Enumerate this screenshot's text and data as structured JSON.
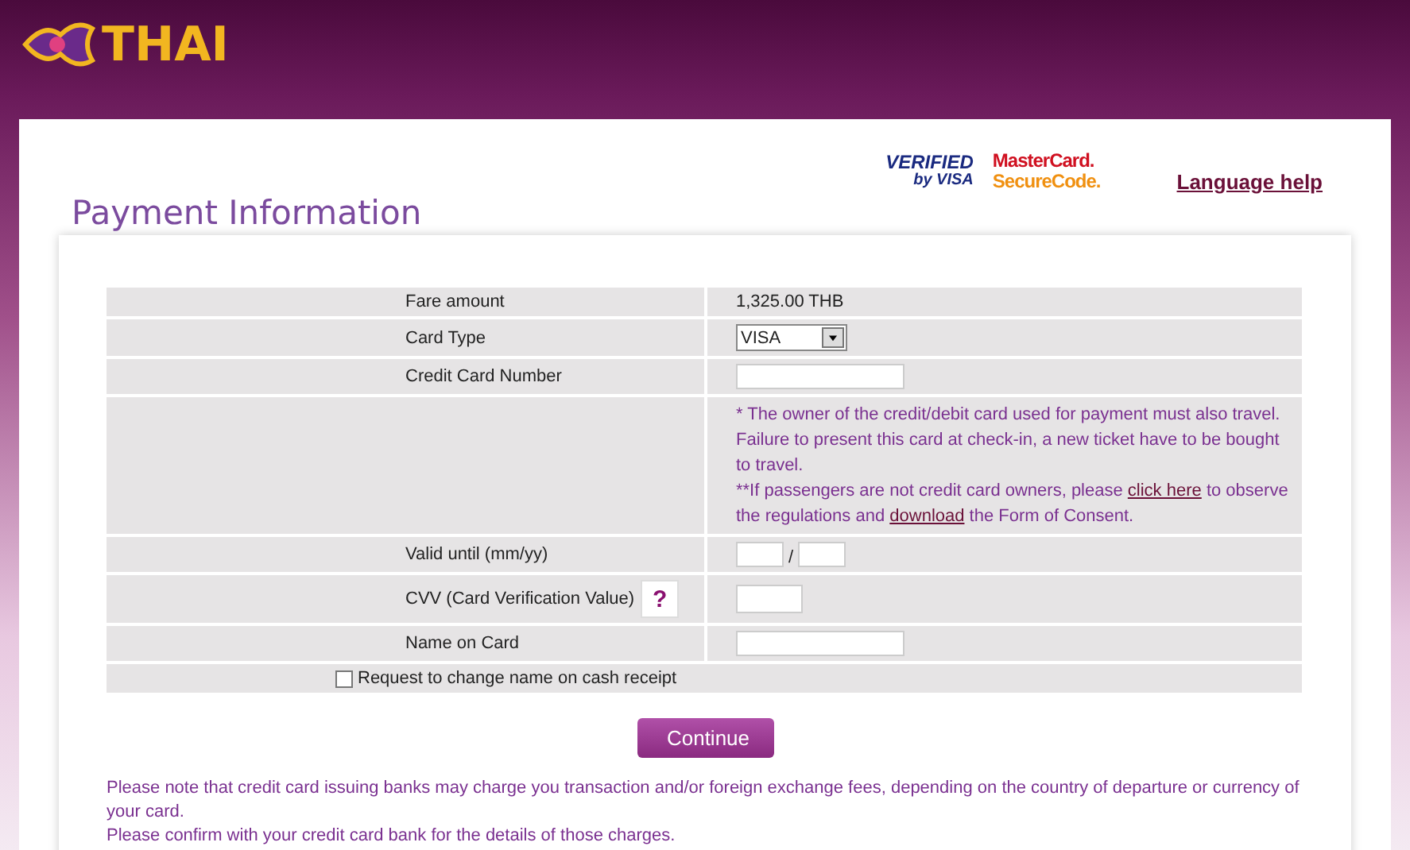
{
  "brand": {
    "name": "THAI"
  },
  "badges": {
    "visa": [
      "VERIFIED",
      "by VISA"
    ],
    "mastercard": [
      "MasterCard.",
      "SecureCode."
    ]
  },
  "language_link": "Language help",
  "title": "Payment Information",
  "rows": [
    {
      "kind": "text",
      "label": "Fare amount",
      "value": "1,325.00 THB"
    },
    {
      "kind": "select",
      "label": "Card Type",
      "value": "VISA"
    },
    {
      "kind": "long-input",
      "label": "Credit Card Number"
    },
    {
      "kind": "note",
      "lines": [
        "* The owner of the credit/debit card used for payment must also travel. Failure to present this card at check-in, a new ticket have to be bought to travel."
      ],
      "parts": [
        {
          "kind": "text",
          "text": "**If passengers are not credit card owners, please "
        },
        {
          "kind": "link",
          "text": "click here"
        },
        {
          "kind": "text",
          "text": " to observe the regulations and "
        },
        {
          "kind": "link",
          "text": "download"
        },
        {
          "kind": "text",
          "text": " the Form of Consent."
        }
      ]
    },
    {
      "kind": "expiry",
      "label": "Valid until (mm/yy)",
      "separator": "/"
    },
    {
      "kind": "cvv",
      "label": "CVV (Card Verification Value)",
      "help": "?"
    },
    {
      "kind": "long-input",
      "label": "Name on Card"
    }
  ],
  "receipt_option": {
    "label": "Request to change name on cash receipt",
    "checked": false
  },
  "continue_button": "Continue",
  "footer_notes": [
    "Please note that credit card issuing banks may charge you transaction and/or foreign exchange fees, depending on the country of departure or currency of your card.",
    "Please confirm with your credit card bank for the details of those charges."
  ]
}
